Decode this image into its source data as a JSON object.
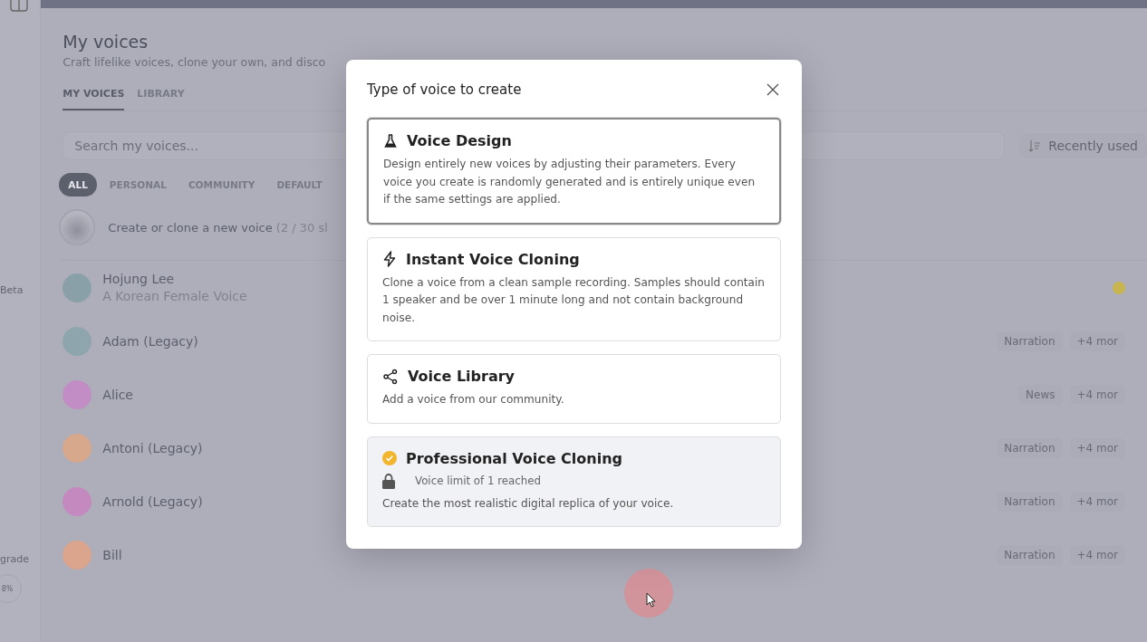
{
  "sidebar": {
    "labels": [
      "Beta",
      "grade"
    ],
    "usage": "8%"
  },
  "header": {
    "title": "My voices",
    "subtitle": "Craft lifelike voices, clone your own, and disco"
  },
  "tabs": [
    {
      "label": "MY VOICES",
      "selected": true
    },
    {
      "label": "LIBRARY",
      "selected": false
    }
  ],
  "search": {
    "placeholder": "Search my voices..."
  },
  "sort": {
    "label": "Recently used"
  },
  "filters": [
    {
      "label": "ALL",
      "selected": true
    },
    {
      "label": "PERSONAL",
      "selected": false
    },
    {
      "label": "COMMUNITY",
      "selected": false
    },
    {
      "label": "DEFAULT",
      "selected": false
    }
  ],
  "create": {
    "label": "Create or clone a new voice",
    "slots": "(2 / 30 sl"
  },
  "voices": [
    {
      "name": "Hojung Lee",
      "description": "A Korean Female Voice",
      "color": "#8aa0a8",
      "flagged": true
    },
    {
      "name": "Adam (Legacy)",
      "color": "#8ea5ad",
      "tags": [
        "Narration",
        "+4 mor"
      ],
      "flagged": false
    },
    {
      "name": "Alice",
      "color": "#c28cc4",
      "tags": [
        "News",
        "+4 mor"
      ],
      "flagged": false
    },
    {
      "name": "Antoni (Legacy)",
      "color": "#d8a88c",
      "tags": [
        "Narration",
        "+4 mor"
      ],
      "flagged": false
    },
    {
      "name": "Arnold (Legacy)",
      "color": "#c489bf",
      "tags": [
        "Narration",
        "+4 mor"
      ],
      "flagged": false
    },
    {
      "name": "Bill",
      "color": "#dba48c",
      "tags": [
        "Narration",
        "+4 mor"
      ],
      "flagged": false
    }
  ],
  "dialog": {
    "title": "Type of voice to create",
    "options": [
      {
        "kind": "flask",
        "title": "Voice Design",
        "description": "Design entirely new voices by adjusting their parameters. Every voice you create is randomly generated and is entirely unique even if the same settings are applied.",
        "selected": true,
        "disabled": false
      },
      {
        "kind": "bolt",
        "title": "Instant Voice Cloning",
        "description": "Clone a voice from a clean sample recording. Samples should contain 1 speaker and be over 1 minute long and not contain background noise.",
        "selected": false,
        "disabled": false
      },
      {
        "kind": "share",
        "title": "Voice Library",
        "description": "Add a voice from our community.",
        "selected": false,
        "disabled": false
      },
      {
        "kind": "verified",
        "title": "Professional Voice Cloning",
        "note": "Voice limit of 1 reached",
        "description": "Create the most realistic digital replica of your voice.",
        "selected": false,
        "disabled": true
      }
    ]
  }
}
